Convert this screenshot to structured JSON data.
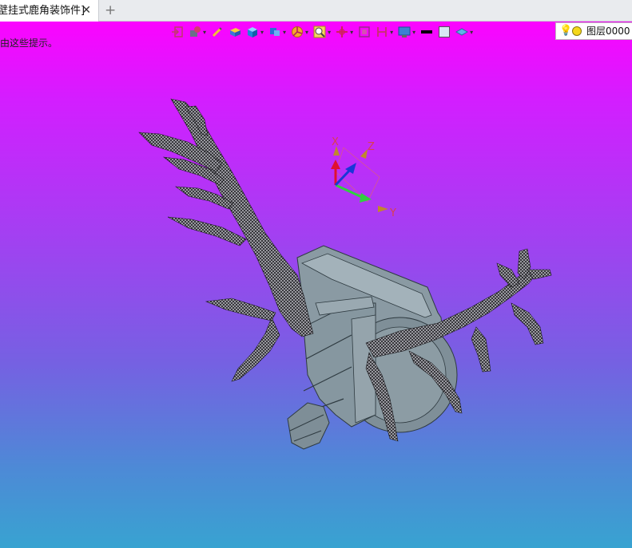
{
  "tab": {
    "title": "壁挂式鹿角装饰件]",
    "close_glyph": "✕"
  },
  "new_tab_glyph": "+",
  "hint_text": "由这些提示。",
  "toolbar": {
    "icons": [
      "exit-view-icon",
      "view-orientation-icon",
      "pick-filter-icon",
      "render-style-icon",
      "shaded-cube-icon",
      "view-cube-icon",
      "display-mode-icon",
      "zoom-fit-icon",
      "triad-icon",
      "section-view-icon",
      "measure-icon",
      "background-color-icon",
      "line-color-swatch-icon",
      "fill-color-swatch-icon",
      "layer-icon"
    ],
    "layer_label": "图层0000"
  },
  "triad": {
    "x_label": "X",
    "y_label": "Y",
    "z_label": "Z"
  },
  "colors": {
    "bg_top": "#fb04ff",
    "bg_bottom": "#38a3d1",
    "model": "#8a9aa3",
    "antler": "#2a2a2e"
  }
}
